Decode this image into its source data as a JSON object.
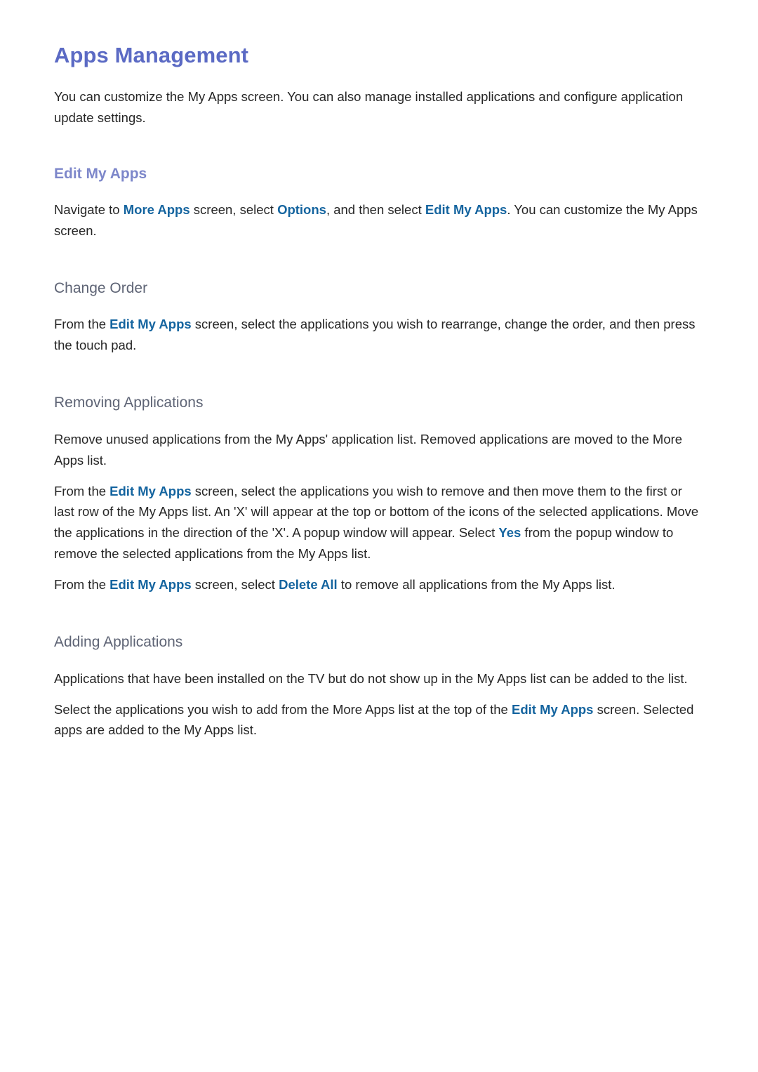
{
  "colors": {
    "page_title": "#5b6ac4",
    "section_heading": "#7d87ca",
    "sub_heading": "#5e6475",
    "body_text": "#262626",
    "ui_term": "#14649f",
    "background": "#ffffff"
  },
  "page": {
    "title": "Apps Management",
    "intro": "You can customize the My Apps screen. You can also manage installed applications and configure application update settings."
  },
  "sections": [
    {
      "heading": "Edit My Apps",
      "heading_type": "section",
      "paragraphs": [
        {
          "parts": [
            {
              "text": "Navigate to ",
              "style": "normal"
            },
            {
              "text": "More Apps",
              "style": "ui-term"
            },
            {
              "text": " screen, select ",
              "style": "normal"
            },
            {
              "text": "Options",
              "style": "ui-term"
            },
            {
              "text": ", and then select ",
              "style": "normal"
            },
            {
              "text": "Edit My Apps",
              "style": "ui-term"
            },
            {
              "text": ". You can customize the My Apps screen.",
              "style": "normal"
            }
          ]
        }
      ]
    },
    {
      "heading": "Change Order",
      "heading_type": "sub",
      "paragraphs": [
        {
          "parts": [
            {
              "text": "From the ",
              "style": "normal"
            },
            {
              "text": "Edit My Apps",
              "style": "ui-term"
            },
            {
              "text": " screen, select the applications you wish to rearrange, change the order, and then press the touch pad.",
              "style": "normal"
            }
          ]
        }
      ]
    },
    {
      "heading": "Removing Applications",
      "heading_type": "sub",
      "paragraphs": [
        {
          "parts": [
            {
              "text": "Remove unused applications from the My Apps' application list. Removed applications are moved to the More Apps list.",
              "style": "normal"
            }
          ]
        },
        {
          "parts": [
            {
              "text": "From the ",
              "style": "normal"
            },
            {
              "text": "Edit My Apps",
              "style": "ui-term"
            },
            {
              "text": " screen, select the applications you wish to remove and then move them to the first or last row of the My Apps list. An 'X' will appear at the top or bottom of the icons of the selected applications. Move the applications in the direction of the 'X'. A popup window will appear. Select ",
              "style": "normal"
            },
            {
              "text": "Yes",
              "style": "ui-term"
            },
            {
              "text": " from the popup window to remove the selected applications from the My Apps list.",
              "style": "normal"
            }
          ]
        },
        {
          "parts": [
            {
              "text": "From the ",
              "style": "normal"
            },
            {
              "text": "Edit My Apps",
              "style": "ui-term"
            },
            {
              "text": " screen, select ",
              "style": "normal"
            },
            {
              "text": "Delete All",
              "style": "ui-term"
            },
            {
              "text": " to remove all applications from the My Apps list.",
              "style": "normal"
            }
          ]
        }
      ]
    },
    {
      "heading": "Adding Applications",
      "heading_type": "sub",
      "paragraphs": [
        {
          "parts": [
            {
              "text": "Applications that have been installed on the TV but do not show up in the My Apps list can be added to the list.",
              "style": "normal"
            }
          ]
        },
        {
          "parts": [
            {
              "text": "Select the applications you wish to add from the More Apps list at the top of the ",
              "style": "normal"
            },
            {
              "text": "Edit My Apps",
              "style": "ui-term"
            },
            {
              "text": " screen. Selected apps are added to the My Apps list.",
              "style": "normal"
            }
          ]
        }
      ]
    }
  ]
}
